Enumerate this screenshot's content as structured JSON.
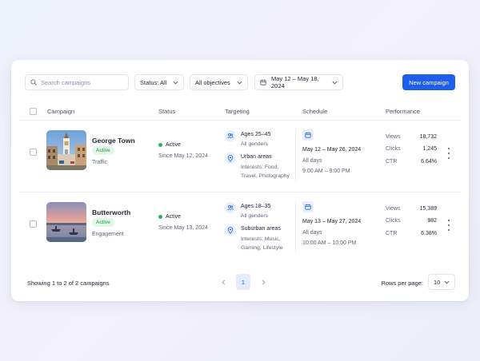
{
  "toolbar": {
    "search_placeholder": "Search campaigns",
    "status_filter": "Status: All",
    "objective_filter": "All objectives",
    "date_range": "May 12 – May 18, 2024",
    "new_campaign_label": "New campaign"
  },
  "table": {
    "columns": [
      "Campaign",
      "Status",
      "Targeting",
      "Schedule",
      "Performance"
    ],
    "rows": [
      {
        "name": "George Town",
        "badge": "Active",
        "objective": "Traffic",
        "status": "Active",
        "since": "Since May 12, 2024",
        "audience": "Ages 25–45",
        "gender": "All genders",
        "area": "Urban areas",
        "interests_1": "Interests: Food,",
        "interests_2": "Travel, Photography",
        "date_range": "May 12 – May 26, 2024",
        "days": "All days",
        "time": "9:00 AM – 9:00 PM",
        "views_label": "Views",
        "views": "18,732",
        "clicks_label": "Clicks",
        "clicks": "1,245",
        "ctr_label": "CTR",
        "ctr": "6.64%"
      },
      {
        "name": "Butterworth",
        "badge": "Active",
        "objective": "Engagement",
        "status": "Active",
        "since": "Since May 13, 2024",
        "audience": "Ages 18–35",
        "gender": "All genders",
        "area": "Suburban areas",
        "interests_1": "Interests: Music,",
        "interests_2": "Gaming, Lifestyle",
        "date_range": "May 13 – May 27, 2024",
        "days": "All days",
        "time": "10:00 AM – 10:00 PM",
        "views_label": "Views",
        "views": "15,389",
        "clicks_label": "Clicks",
        "clicks": "982",
        "ctr_label": "CTR",
        "ctr": "6.38%"
      }
    ]
  },
  "footer": {
    "showing": "Showing 1 to 2 of 2 campaigns",
    "current_page": "1",
    "rows_per_page_label": "Rows per page:",
    "rows_per_page": "10"
  },
  "colors": {
    "accent": "#1f5ee8",
    "active_green": "#29b35d",
    "badge_bg": "#e3f6e8"
  },
  "icons": [
    "search-icon",
    "chevron-down-icon",
    "calendar-icon",
    "users-icon",
    "location-pin-icon",
    "more-vertical-icon",
    "chevron-left-icon",
    "chevron-right-icon"
  ]
}
